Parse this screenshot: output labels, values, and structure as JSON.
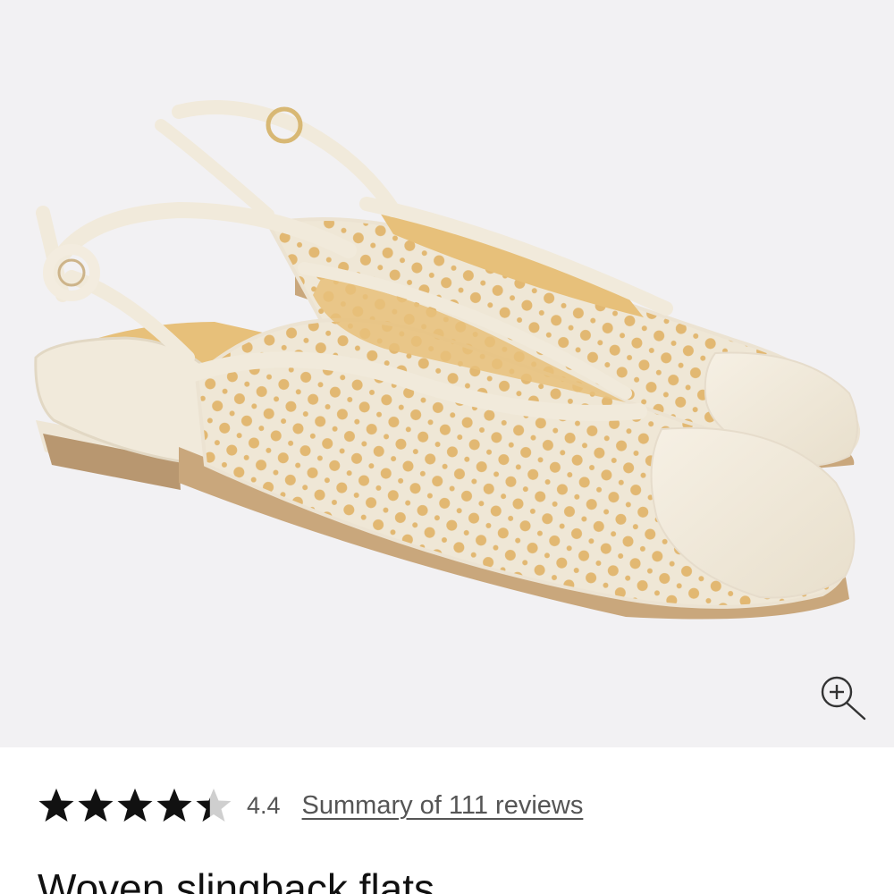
{
  "product": {
    "image_alt": "Woven slingback flats product photo",
    "shoe_color": "#f1eadb",
    "insole_color": "#e7c07a",
    "title": "Woven slingback flats"
  },
  "zoom": {
    "icon": "zoom-in-icon"
  },
  "rating": {
    "value_number": 4.4,
    "max_stars": 5,
    "value": "4.4",
    "reviews_link": "Summary of 111 reviews",
    "star_color": "#111111",
    "empty_star_color": "#cfcfcf"
  }
}
